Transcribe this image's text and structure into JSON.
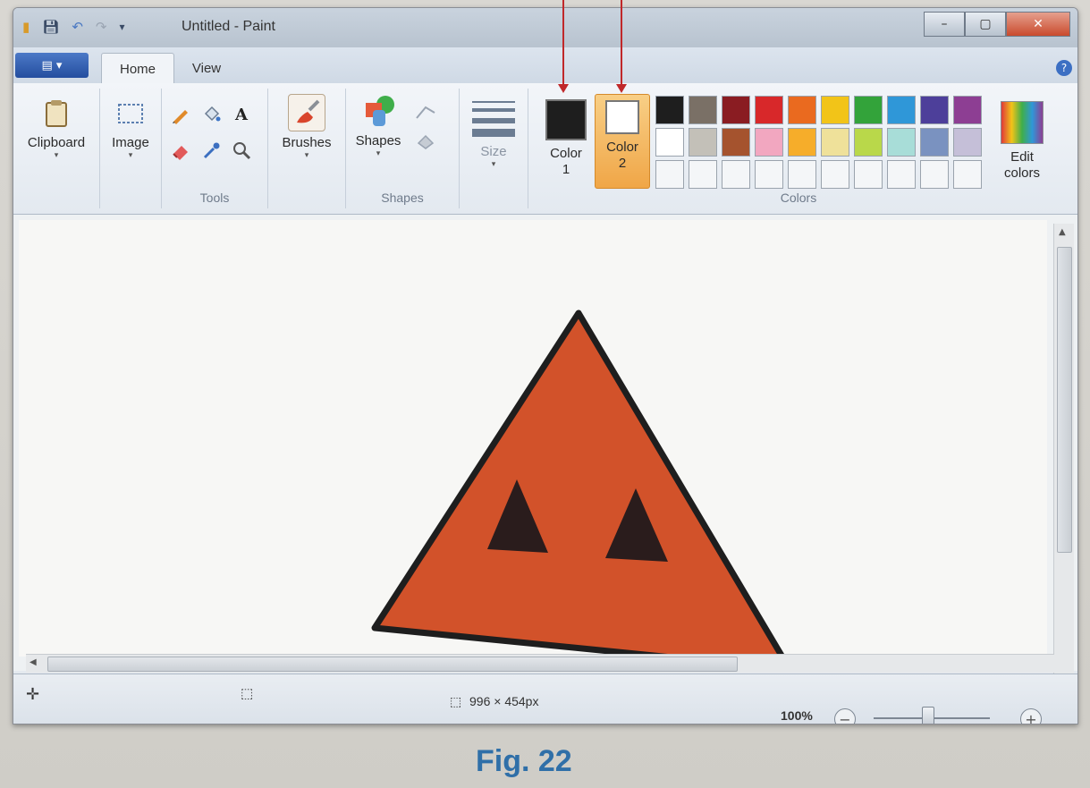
{
  "titlebar": {
    "title": "Untitled - Paint",
    "quick_access_icons": [
      "paint-app-icon",
      "save-icon",
      "undo-icon",
      "redo-icon",
      "customize-qat-icon"
    ],
    "window_buttons": {
      "minimize": "–",
      "maximize": "▢",
      "close": "✕"
    }
  },
  "tabs": {
    "menu_button": "▤ ▾",
    "items": [
      {
        "label": "Home",
        "active": true
      },
      {
        "label": "View",
        "active": false
      }
    ],
    "help": "?"
  },
  "ribbon": {
    "clipboard": {
      "label": "Clipboard",
      "arrow": "▾",
      "icon": "clipboard-icon"
    },
    "image": {
      "label": "Image",
      "arrow": "▾",
      "icon": "select-icon"
    },
    "tools": {
      "label": "Tools",
      "icons": [
        "pencil-icon",
        "fill-icon",
        "text-icon",
        "eraser-icon",
        "color-picker-icon",
        "magnifier-icon"
      ],
      "text_glyph": "A"
    },
    "brushes": {
      "label": "Brushes",
      "arrow": "▾",
      "icon": "brush-icon"
    },
    "shapes": {
      "label": "Shapes",
      "group_label": "Shapes",
      "arrow": "▾",
      "icon": "shapes-icon"
    },
    "size": {
      "label": "Size",
      "arrow": "▾"
    },
    "color1": {
      "label_line1": "Color",
      "label_line2": "1",
      "color": "#1e1e1e"
    },
    "color2": {
      "label_line1": "Color",
      "label_line2": "2",
      "color": "#ffffff",
      "highlight": "#f3b35a"
    },
    "colors_group_label": "Colors",
    "edit_colors": {
      "line1": "Edit",
      "line2": "colors"
    },
    "palette": [
      "#1e1e1e",
      "#7a7066",
      "#8a1c22",
      "#d8282a",
      "#ea6a1f",
      "#f2c418",
      "#33a33a",
      "#2f97d8",
      "#4d3f9a",
      "#8d3e93",
      "#ffffff",
      "#c3c0b8",
      "#a5532e",
      "#f2a7c0",
      "#f6ad2a",
      "#efe19a",
      "#b9d84a",
      "#a8ddd8",
      "#7a92c0",
      "#c5bfd8",
      "#f4f6f8",
      "#f4f6f8",
      "#f4f6f8",
      "#f4f6f8",
      "#f4f6f8",
      "#f4f6f8",
      "#f4f6f8",
      "#f4f6f8",
      "#f4f6f8",
      "#f4f6f8"
    ]
  },
  "canvas": {
    "drawing": "orange-triangle-with-two-dark-triangle-eyes",
    "triangle_fill": "#d2522a",
    "outline_color": "#1e1e1e"
  },
  "statusbar": {
    "dimensions": "996 × 454px",
    "zoom": "100%",
    "zoom_out": "−",
    "zoom_in": "+"
  },
  "caption": "Fig. 22",
  "annotation_color": "#c0282a"
}
